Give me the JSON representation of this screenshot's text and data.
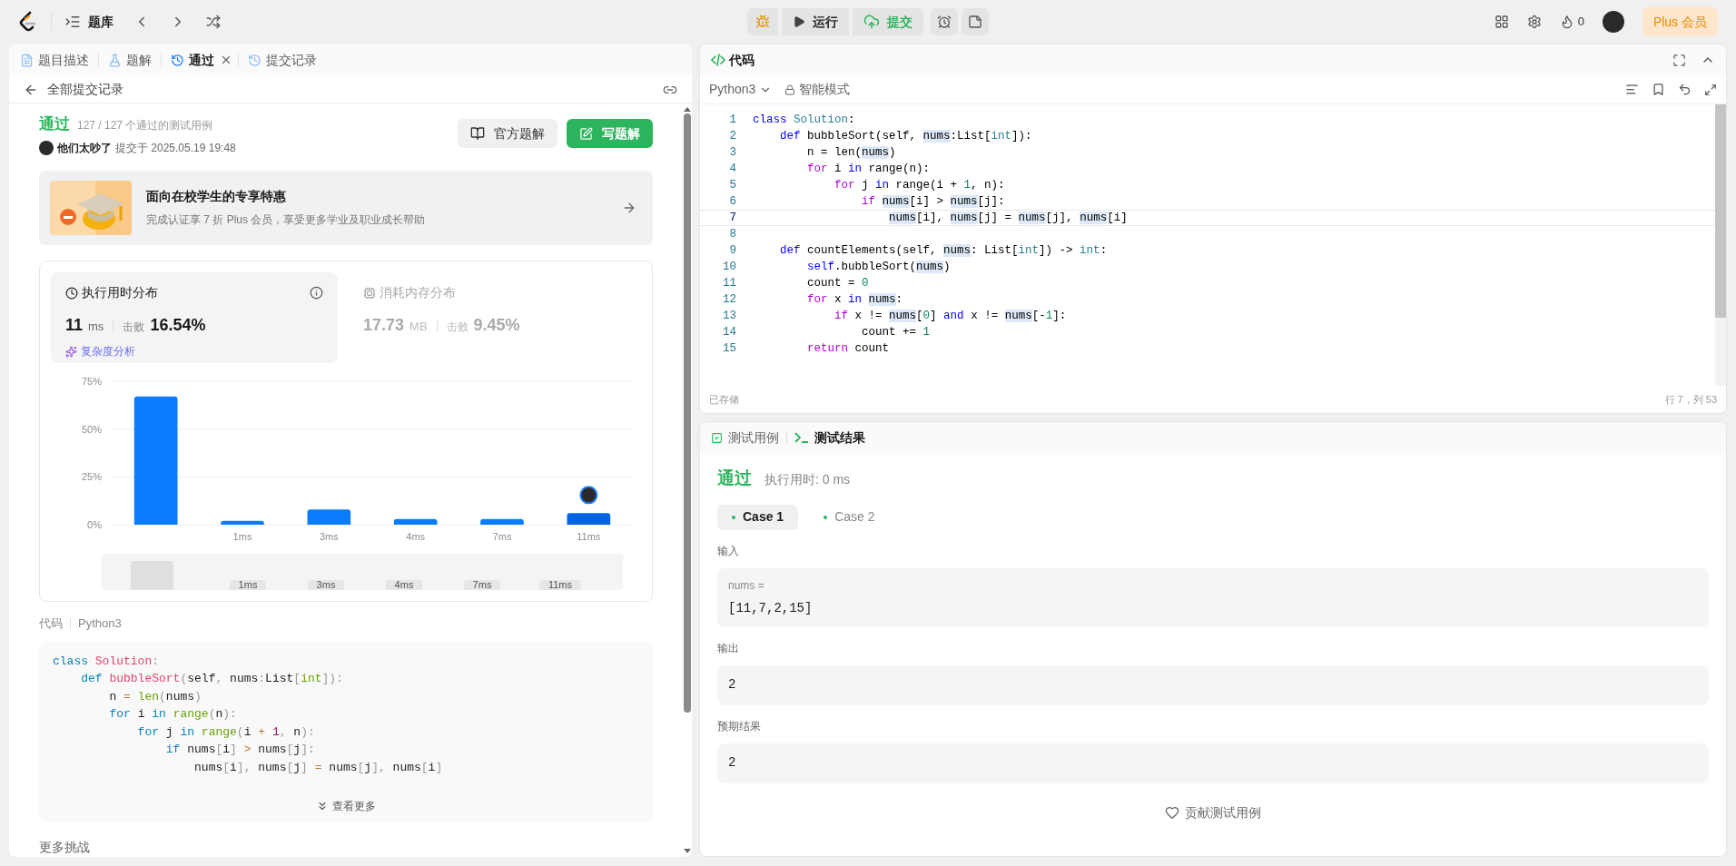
{
  "top_bar": {
    "library": "题库",
    "run": "运行",
    "submit": "提交",
    "streak": "0",
    "plus": "Plus 会员"
  },
  "left_tabs": [
    {
      "label": "题目描述",
      "kind": "doc",
      "selected": false,
      "closable": false
    },
    {
      "label": "题解",
      "kind": "flask",
      "selected": false,
      "closable": false
    },
    {
      "label": "通过",
      "kind": "history",
      "selected": true,
      "closable": true
    },
    {
      "label": "提交记录",
      "kind": "history",
      "selected": false,
      "closable": false
    }
  ],
  "back_link": "全部提交记录",
  "result": {
    "status": "通过",
    "cases": "127 / 127 个通过的测试用例",
    "user": "他们太吵了",
    "submitted": "提交于 2025.05.19 19:48",
    "official_button": "官方题解",
    "write_button": "写题解"
  },
  "promo": {
    "title": "面向在校学生的专享特惠",
    "subtitle": "完成认证享 7 折 Plus 会员，享受更多学业及职业成长帮助"
  },
  "stats": [
    {
      "kind": "time",
      "title": "执行用时分布",
      "value": "11",
      "unit": "ms",
      "beat_label": "击败",
      "beat": "16.54%",
      "selected": true,
      "link": "复杂度分析"
    },
    {
      "kind": "memory",
      "title": "消耗内存分布",
      "value": "17.73",
      "unit": "MB",
      "beat_label": "击败",
      "beat": "9.45%",
      "selected": false
    }
  ],
  "chart_data": {
    "type": "bar",
    "categories": [
      null,
      "1ms",
      "3ms",
      "4ms",
      "7ms",
      "11ms"
    ],
    "stacked": true,
    "series": [
      {
        "color": "#0a7cff",
        "values": [
          67,
          2,
          8,
          3,
          3,
          null
        ]
      },
      {
        "color": "#0066e0",
        "values": [
          null,
          null,
          null,
          null,
          null,
          6
        ]
      }
    ],
    "ylim": [
      0,
      75
    ],
    "yticks": [
      {
        "value": 0,
        "label": "0%"
      },
      {
        "value": 25,
        "label": "25%"
      },
      {
        "value": 50,
        "label": "50%"
      },
      {
        "value": 75,
        "label": "75%"
      }
    ]
  },
  "overview_labels": [
    "1ms",
    "3ms",
    "4ms",
    "7ms",
    "11ms"
  ],
  "code_section": {
    "label": "代码",
    "language": "Python3",
    "more": "查看更多",
    "footer": "更多挑战"
  },
  "submitted_code": [
    [
      {
        "text": "class",
        "kind": "kw"
      },
      {
        "text": " Solution",
        "kind": "title"
      },
      {
        "text": ":",
        "kind": "punct"
      }
    ],
    [
      {
        "text": "    def",
        "kind": "kw"
      },
      {
        "text": " bubbleSort",
        "kind": "title"
      },
      {
        "text": "(",
        "kind": "punct"
      },
      {
        "text": "self",
        "kind": "plain"
      },
      {
        "text": ", ",
        "kind": "punct"
      },
      {
        "text": "nums",
        "kind": "plain"
      },
      {
        "text": ":",
        "kind": "punct"
      },
      {
        "text": "List",
        "kind": "plain"
      },
      {
        "text": "[",
        "kind": "punct"
      },
      {
        "text": "int",
        "kind": "builtin"
      },
      {
        "text": "]):",
        "kind": "punct"
      }
    ],
    [
      {
        "text": "        n ",
        "kind": "plain"
      },
      {
        "text": "=",
        "kind": "op"
      },
      {
        "text": " len",
        "kind": "builtin"
      },
      {
        "text": "(",
        "kind": "punct"
      },
      {
        "text": "nums",
        "kind": "plain"
      },
      {
        "text": ")",
        "kind": "punct"
      }
    ],
    [
      {
        "text": "        for",
        "kind": "kw"
      },
      {
        "text": " i ",
        "kind": "plain"
      },
      {
        "text": "in",
        "kind": "kw"
      },
      {
        "text": " range",
        "kind": "builtin"
      },
      {
        "text": "(",
        "kind": "punct"
      },
      {
        "text": "n",
        "kind": "plain"
      },
      {
        "text": "):",
        "kind": "punct"
      }
    ],
    [
      {
        "text": "            for",
        "kind": "kw"
      },
      {
        "text": " j ",
        "kind": "plain"
      },
      {
        "text": "in",
        "kind": "kw"
      },
      {
        "text": " range",
        "kind": "builtin"
      },
      {
        "text": "(",
        "kind": "punct"
      },
      {
        "text": "i ",
        "kind": "plain"
      },
      {
        "text": "+",
        "kind": "op"
      },
      {
        "text": " 1",
        "kind": "num"
      },
      {
        "text": ", ",
        "kind": "punct"
      },
      {
        "text": "n",
        "kind": "plain"
      },
      {
        "text": "):",
        "kind": "punct"
      }
    ],
    [
      {
        "text": "                if",
        "kind": "kw"
      },
      {
        "text": " nums",
        "kind": "plain"
      },
      {
        "text": "[",
        "kind": "punct"
      },
      {
        "text": "i",
        "kind": "plain"
      },
      {
        "text": "]",
        "kind": "punct"
      },
      {
        "text": " >",
        "kind": "op"
      },
      {
        "text": " nums",
        "kind": "plain"
      },
      {
        "text": "[",
        "kind": "punct"
      },
      {
        "text": "j",
        "kind": "plain"
      },
      {
        "text": "]:",
        "kind": "punct"
      }
    ],
    [
      {
        "text": "                    nums",
        "kind": "plain"
      },
      {
        "text": "[",
        "kind": "punct"
      },
      {
        "text": "i",
        "kind": "plain"
      },
      {
        "text": "], ",
        "kind": "punct"
      },
      {
        "text": "nums",
        "kind": "plain"
      },
      {
        "text": "[",
        "kind": "punct"
      },
      {
        "text": "j",
        "kind": "plain"
      },
      {
        "text": "]",
        "kind": "punct"
      },
      {
        "text": " =",
        "kind": "op"
      },
      {
        "text": " nums",
        "kind": "plain"
      },
      {
        "text": "[",
        "kind": "punct"
      },
      {
        "text": "j",
        "kind": "plain"
      },
      {
        "text": "], ",
        "kind": "punct"
      },
      {
        "text": "nums",
        "kind": "plain"
      },
      {
        "text": "[",
        "kind": "punct"
      },
      {
        "text": "i",
        "kind": "plain"
      },
      {
        "text": "]",
        "kind": "punct"
      }
    ]
  ],
  "editor": {
    "title": "代码",
    "language": "Python3",
    "mode": "智能模式",
    "saved": "已存储",
    "position": "行 7，列 53",
    "lines": [
      {
        "number": "1",
        "current": false,
        "tokens": [
          {
            "text": "class",
            "kind": "kw"
          },
          {
            "text": " Solution",
            "kind": "type"
          },
          {
            "text": ":",
            "kind": "plain"
          }
        ]
      },
      {
        "number": "2",
        "current": false,
        "tokens": [
          {
            "text": "    def",
            "kind": "kw"
          },
          {
            "text": " bubbleSort(self, ",
            "kind": "plain"
          },
          {
            "text": "nums",
            "kind": "ref"
          },
          {
            "text": ":List[",
            "kind": "plain"
          },
          {
            "text": "int",
            "kind": "type"
          },
          {
            "text": "]):",
            "kind": "plain"
          }
        ]
      },
      {
        "number": "3",
        "current": false,
        "tokens": [
          {
            "text": "        n = len(",
            "kind": "plain"
          },
          {
            "text": "nums",
            "kind": "ref"
          },
          {
            "text": ")",
            "kind": "plain"
          }
        ]
      },
      {
        "number": "4",
        "current": false,
        "tokens": [
          {
            "text": "        for",
            "kind": "ctrl"
          },
          {
            "text": " i ",
            "kind": "plain"
          },
          {
            "text": "in",
            "kind": "kw"
          },
          {
            "text": " range(n):",
            "kind": "plain"
          }
        ]
      },
      {
        "number": "5",
        "current": false,
        "tokens": [
          {
            "text": "            for",
            "kind": "ctrl"
          },
          {
            "text": " j ",
            "kind": "plain"
          },
          {
            "text": "in",
            "kind": "kw"
          },
          {
            "text": " range(i + ",
            "kind": "plain"
          },
          {
            "text": "1",
            "kind": "num"
          },
          {
            "text": ", n):",
            "kind": "plain"
          }
        ]
      },
      {
        "number": "6",
        "current": false,
        "tokens": [
          {
            "text": "                if ",
            "kind": "ctrl"
          },
          {
            "text": "nums",
            "kind": "ref"
          },
          {
            "text": "[i] > ",
            "kind": "plain"
          },
          {
            "text": "nums",
            "kind": "ref"
          },
          {
            "text": "[j]:",
            "kind": "plain"
          }
        ]
      },
      {
        "number": "7",
        "current": true,
        "tokens": [
          {
            "text": "                    nums",
            "kind": "ref"
          },
          {
            "text": "[i], ",
            "kind": "plain"
          },
          {
            "text": "nums",
            "kind": "ref"
          },
          {
            "text": "[j] = ",
            "kind": "plain"
          },
          {
            "text": "nums",
            "kind": "ref"
          },
          {
            "text": "[j], ",
            "kind": "plain"
          },
          {
            "text": "nums",
            "kind": "ref"
          },
          {
            "text": "[i]",
            "kind": "plain"
          }
        ]
      },
      {
        "number": "8",
        "current": false
      },
      {
        "number": "9",
        "current": false,
        "tokens": [
          {
            "text": "    def",
            "kind": "kw"
          },
          {
            "text": " countElements(self, ",
            "kind": "plain"
          },
          {
            "text": "nums",
            "kind": "ref"
          },
          {
            "text": ": List[",
            "kind": "plain"
          },
          {
            "text": "int",
            "kind": "type"
          },
          {
            "text": "]) -> ",
            "kind": "plain"
          },
          {
            "text": "int",
            "kind": "type"
          },
          {
            "text": ":",
            "kind": "plain"
          }
        ]
      },
      {
        "number": "10",
        "current": false,
        "tokens": [
          {
            "text": "        self",
            "kind": "kw"
          },
          {
            "text": ".bubbleSort(",
            "kind": "plain"
          },
          {
            "text": "nums",
            "kind": "ref"
          },
          {
            "text": ")",
            "kind": "plain"
          }
        ]
      },
      {
        "number": "11",
        "current": false,
        "tokens": [
          {
            "text": "        count = ",
            "kind": "plain"
          },
          {
            "text": "0",
            "kind": "num"
          }
        ]
      },
      {
        "number": "12",
        "current": false,
        "tokens": [
          {
            "text": "        for",
            "kind": "ctrl"
          },
          {
            "text": " x ",
            "kind": "plain"
          },
          {
            "text": "in ",
            "kind": "kw"
          },
          {
            "text": "nums",
            "kind": "ref"
          },
          {
            "text": ":",
            "kind": "plain"
          }
        ]
      },
      {
        "number": "13",
        "current": false,
        "tokens": [
          {
            "text": "            if",
            "kind": "ctrl"
          },
          {
            "text": " x != ",
            "kind": "plain"
          },
          {
            "text": "nums",
            "kind": "ref"
          },
          {
            "text": "[",
            "kind": "plain"
          },
          {
            "text": "0",
            "kind": "num"
          },
          {
            "text": "] ",
            "kind": "plain"
          },
          {
            "text": "and",
            "kind": "kw"
          },
          {
            "text": " x != ",
            "kind": "plain"
          },
          {
            "text": "nums",
            "kind": "ref"
          },
          {
            "text": "[-",
            "kind": "plain"
          },
          {
            "text": "1",
            "kind": "num"
          },
          {
            "text": "]:",
            "kind": "plain"
          }
        ]
      },
      {
        "number": "14",
        "current": false,
        "tokens": [
          {
            "text": "                count += ",
            "kind": "plain"
          },
          {
            "text": "1",
            "kind": "num"
          }
        ]
      },
      {
        "number": "15",
        "current": false,
        "tokens": [
          {
            "text": "        return",
            "kind": "ctrl"
          },
          {
            "text": " count",
            "kind": "plain"
          }
        ]
      }
    ]
  },
  "test_tabs": [
    {
      "label": "测试用例",
      "kind": "cases",
      "selected": false
    },
    {
      "label": "测试结果",
      "kind": "result",
      "selected": true
    }
  ],
  "test_result": {
    "status": "通过",
    "runtime": "执行用时: 0 ms",
    "cases": [
      {
        "label": "Case 1",
        "selected": true
      },
      {
        "label": "Case 2",
        "selected": false
      }
    ],
    "input_label": "输入",
    "input_name": "nums =",
    "input_value": "[11,7,2,15]",
    "output_label": "输出",
    "output_value": "2",
    "expected_label": "预期结果",
    "expected_value": "2",
    "contribute": "贡献测试用例"
  }
}
